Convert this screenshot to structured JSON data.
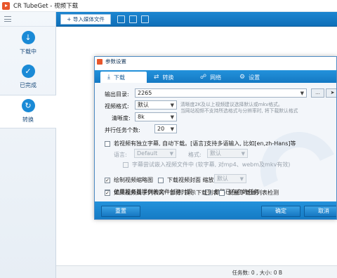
{
  "window": {
    "title": "CR TubeGet - 视频下载"
  },
  "toolbar": {
    "import_label": "+ 导入媒体文件"
  },
  "sidebar": {
    "items": [
      {
        "label": "下载中",
        "icon": "download-icon"
      },
      {
        "label": "已完成",
        "icon": "check-icon"
      },
      {
        "label": "转换",
        "icon": "convert-icon"
      }
    ]
  },
  "status": {
    "text": "任务数: 0 , 大小: 0 B"
  },
  "dialog": {
    "title": "参数设置",
    "tabs": [
      {
        "label": "下载",
        "icon": "download-icon"
      },
      {
        "label": "转换",
        "icon": "convert-icon"
      },
      {
        "label": "网络",
        "icon": "globe-icon"
      },
      {
        "label": "设置",
        "icon": "gear-icon"
      }
    ],
    "output_dir_label": "输出目录:",
    "output_dir_value": "2265",
    "browse_label": "...",
    "video_format_label": "视频格式:",
    "video_format_value": "默认",
    "hint_line1": "清晰度2K及以上视频建议选择默认或mkv格式。",
    "hint_line2": "当网站视频不支持所选格式与分辨率时, 将下载默认格式",
    "resolution_label": "清晰度:",
    "resolution_value": "8k",
    "parallel_label": "并行任务个数:",
    "parallel_value": "20",
    "subtitle_check_label": "若视频有独立字幕, 自动下载。[语言]支持多语输入, 比如[en,zh-Hans]等",
    "language_label": "语言:",
    "language_value": "Default",
    "sub_format_label": "格式:",
    "sub_format_value": "默认",
    "embed_sub_label": "字幕尝试嵌入视频文件中 (软字幕, 对mp4、webm及mkv有效)",
    "thumbnail_label": "绘制视频缩略图",
    "cover_label": "下载视频封面 缩放:",
    "cover_value": "默认",
    "server_time_label": "使用服务器提供的文件创建时间",
    "ignore_existing_label": "忽略已存在的任务",
    "playlist_label": "如果视频属于列表的一部分, 提示下载列表",
    "batch_label": "批量下载做列表检测",
    "reset_label": "重置",
    "ok_label": "确定",
    "cancel_label": "取消"
  },
  "colors": {
    "accent": "#1a8ad6",
    "toolbar": "#1479c3",
    "brand": "#e8562b"
  }
}
